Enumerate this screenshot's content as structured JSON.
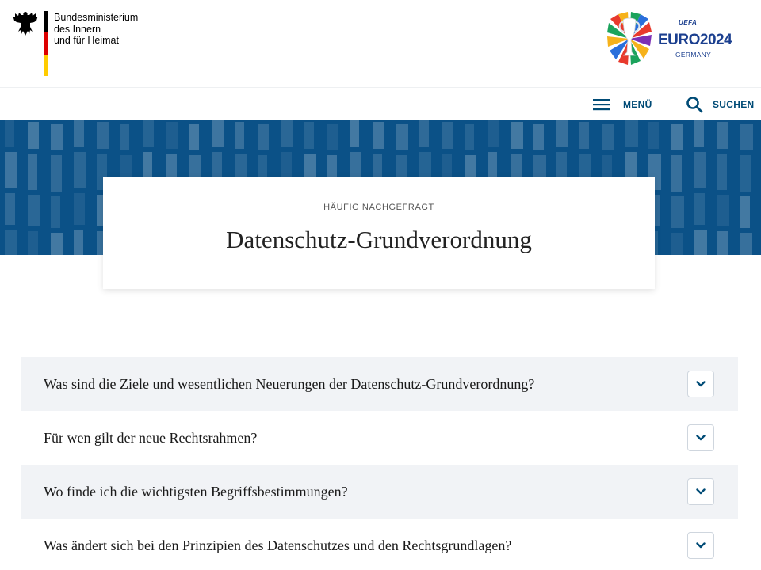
{
  "header": {
    "ministry_lines": [
      "Bundesministerium",
      "des Innern",
      "und für Heimat"
    ],
    "euro_logo": {
      "uefa": "UEFA",
      "main": "EURO2024",
      "country": "GERMANY"
    },
    "flag_colors": [
      "#000000",
      "#dd0000",
      "#ffcc00"
    ]
  },
  "nav": {
    "menu_label": "MENÜ",
    "menu_icon": "hamburger-icon",
    "search_label": "SUCHEN",
    "search_icon": "search-icon"
  },
  "hero": {
    "kicker": "HÄUFIG NACHGEFRAGT",
    "title": "Datenschutz-Grundverordnung",
    "banner_color": "#0b5187"
  },
  "faq": {
    "items": [
      {
        "question": "Was sind die Ziele und wesentlichen Neuerungen der Datenschutz-Grundverordnung?"
      },
      {
        "question": "Für wen gilt der neue Rechtsrahmen?"
      },
      {
        "question": "Wo finde ich die wichtigsten Begriffsbestimmungen?"
      },
      {
        "question": "Was ändert sich bei den Prinzipien des Datenschutzes und den Rechtsgrundlagen?"
      }
    ],
    "toggle_icon": "chevron-down-icon"
  },
  "colors": {
    "accent": "#004b76",
    "faq_shade": "#f1f3f6"
  }
}
